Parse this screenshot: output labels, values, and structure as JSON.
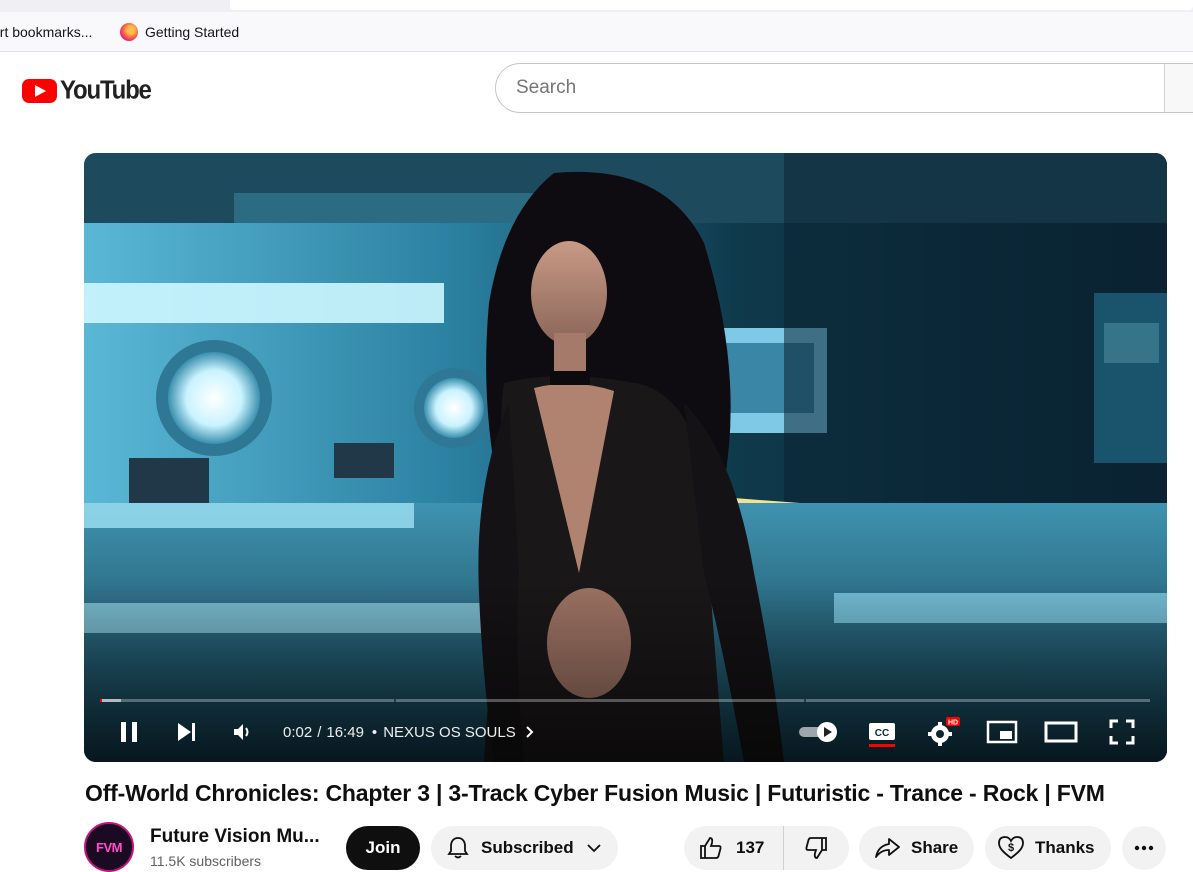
{
  "browser": {
    "bookmarks": [
      {
        "label": "ort bookmarks..."
      },
      {
        "label": "Getting Started"
      }
    ]
  },
  "masthead": {
    "logo_text": "YouTube",
    "search_placeholder": "Search"
  },
  "player": {
    "time_current": "0:02",
    "time_separator": "/",
    "time_total": "16:49",
    "chapter_dot": "•",
    "chapter_name": "NEXUS OS SOULS",
    "progress_played": 0.002,
    "progress_loaded": 0.02,
    "chapter_breaks": [
      0.28,
      0.67
    ],
    "settings_badge": "HD",
    "autoplay_on": true,
    "captions_on": true
  },
  "video": {
    "title": "Off-World Chronicles: Chapter 3 | 3-Track Cyber Fusion Music | Futuristic - Trance - Rock | FVM"
  },
  "owner": {
    "avatar_text": "FVM",
    "channel_name": "Future Vision Mu...",
    "subscribers": "11.5K subscribers"
  },
  "actions": {
    "join_label": "Join",
    "subscribed_label": "Subscribed",
    "like_count": "137",
    "share_label": "Share",
    "thanks_label": "Thanks"
  },
  "colors": {
    "brand_red": "#ff0000",
    "progress_red": "#ff0000",
    "button_bg": "#f2f2f2",
    "join_bg": "#0f0f0f"
  }
}
